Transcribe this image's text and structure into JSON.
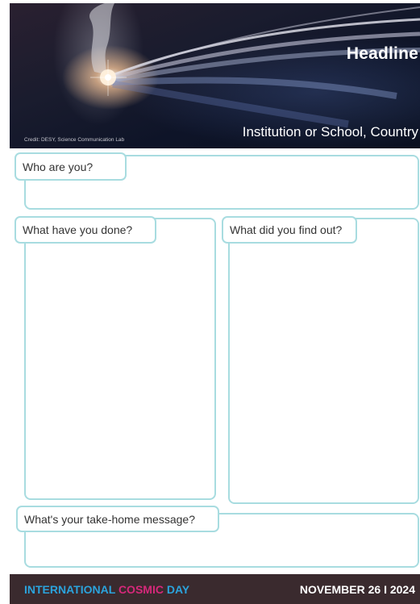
{
  "banner": {
    "headline": "Headline",
    "institution": "Institution or School, Country",
    "credit": "Credit: DESY, Science Communication Lab"
  },
  "sections": {
    "who": "Who are you?",
    "done": "What have you done?",
    "found": "What did you find out?",
    "message": "What's your take-home message?"
  },
  "footer": {
    "brand_word1": "INTERNATIONAL",
    "brand_word2": "COSMIC",
    "brand_word3": "DAY",
    "date": "NOVEMBER 26 I 2024"
  },
  "colors": {
    "box_border": "#a8dce0",
    "footer_bg": "#3a2a2e",
    "brand_blue": "#2ba3dc",
    "brand_pink": "#d6287a"
  }
}
